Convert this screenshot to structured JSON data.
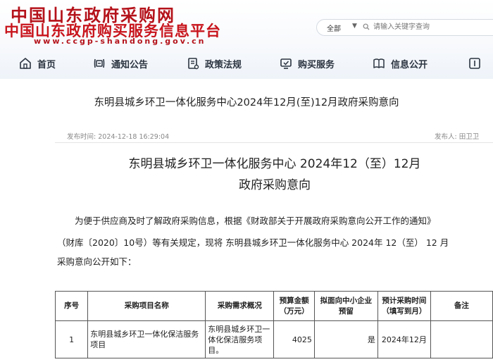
{
  "site": {
    "title_line1": "中国山东政府采购网",
    "title_line2": "中国山东政府购买服务信息平台",
    "url": "www.ccgp-shandong.gov.cn"
  },
  "search": {
    "scope": "全部",
    "placeholder": "请输入关键字查询"
  },
  "nav": {
    "items": [
      {
        "label": "首页",
        "icon": "home-icon"
      },
      {
        "label": "通知公告",
        "icon": "notice-icon"
      },
      {
        "label": "政策法规",
        "icon": "policy-icon"
      },
      {
        "label": "购买服务",
        "icon": "service-icon"
      },
      {
        "label": "信息公开",
        "icon": "info-icon"
      },
      {
        "label": "",
        "icon": "more-icon"
      }
    ]
  },
  "article": {
    "title": "东明县城乡环卫一体化服务中心2024年12月(至)12月政府采购意向",
    "date_label": "发布时间:",
    "date": "2024-12-18 16:29:04",
    "author_label": "发布人:",
    "author": "田卫卫",
    "doc_title_line1": "东明县城乡环卫一体化服务中心 2024年12（至）12月",
    "doc_title_line2": "政府采购意向",
    "paragraph_line1": "为便于供应商及时了解政府采购信息，根据《财政部关于开展政府采购意向公开工作的通知》",
    "paragraph_line2": "（财库〔2020〕10号）等有关规定，现将 东明县城乡环卫一体化服务中心    2024年 12（至） 12 月",
    "paragraph_line3": "采购意向公开如下："
  },
  "table": {
    "headers": [
      "序号",
      "采购项目名称",
      "采购需求概况",
      "预算金额（万元）",
      "拟面向中小企业预留",
      "预计采购时间（填写到月）",
      "备注"
    ],
    "rows": [
      {
        "index": "1",
        "name": "东明县城乡环卫一体化保洁服务项目",
        "summary": "东明县城乡环卫一体化保洁服务项目。",
        "budget": "4025",
        "sme": "是",
        "time": "2024年12月",
        "remark": ""
      }
    ]
  },
  "colors": {
    "logo_red": "#c8141c",
    "nav_text": "#2b3440"
  }
}
